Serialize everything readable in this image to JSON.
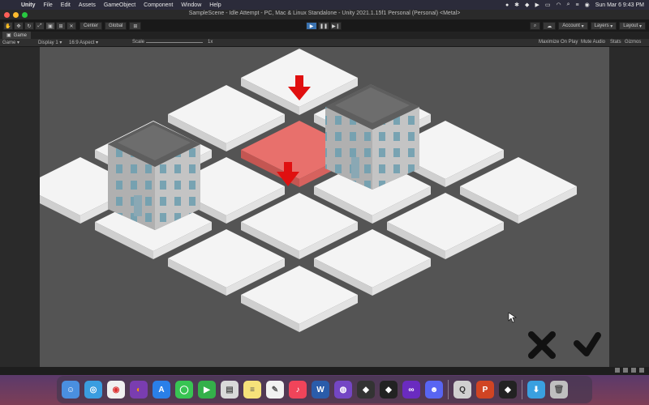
{
  "menubar": {
    "app_name": "Unity",
    "items": [
      "File",
      "Edit",
      "Assets",
      "GameObject",
      "Component",
      "Window",
      "Help"
    ],
    "clock": "Sun Mar 6  9:43 PM"
  },
  "window": {
    "title": "SampleScene - Idle Attempt - PC, Mac & Linux Standalone - Unity 2021.1.15f1 Personal (Personal) <Metal>"
  },
  "toolbar": {
    "pivot_label": "Center",
    "space_label": "Global",
    "account_label": "Account",
    "layers_label": "Layers",
    "layout_label": "Layout"
  },
  "game_tab": {
    "label": "Game"
  },
  "game_view": {
    "mode_label": "Game",
    "display_label": "Display 1",
    "aspect_label": "16:9 Aspect",
    "scale_label": "Scale",
    "scale_value": "1x",
    "maximize_label": "Maximize On Play",
    "mute_label": "Mute Audio",
    "stats_label": "Stats",
    "gizmos_label": "Gizmos"
  },
  "scene": {
    "selected_tile_color": "#e8706c",
    "tile_color": "#f0f0f0",
    "arrow_color": "#e01010",
    "building_count": 2
  },
  "dock": {
    "apps": [
      "Finder",
      "Safari",
      "Chrome",
      "Firefox",
      "App Store",
      "Messages",
      "FaceTime",
      "Preview",
      "Notes",
      "TextEdit",
      "Music",
      "Word",
      "GitHub Desktop",
      "Unity Hub",
      "Unity",
      "Visual Studio",
      "Discord",
      "QuickTime",
      "PowerPoint",
      "Unity",
      "Downloads",
      "Trash"
    ]
  }
}
